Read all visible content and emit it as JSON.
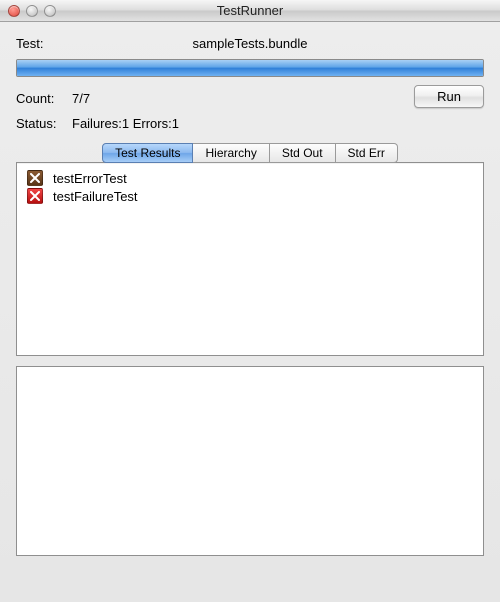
{
  "window": {
    "title": "TestRunner"
  },
  "testLabel": "Test:",
  "testName": "sampleTests.bundle",
  "progress": {
    "percent": 100
  },
  "count": {
    "label": "Count:",
    "value": "7/7"
  },
  "status": {
    "label": "Status:",
    "value": "Failures:1 Errors:1"
  },
  "runButton": "Run",
  "tabs": [
    {
      "label": "Test Results",
      "selected": true
    },
    {
      "label": "Hierarchy",
      "selected": false
    },
    {
      "label": "Std Out",
      "selected": false
    },
    {
      "label": "Std Err",
      "selected": false
    }
  ],
  "results": [
    {
      "name": "testErrorTest",
      "kind": "error"
    },
    {
      "name": "testFailureTest",
      "kind": "failure"
    }
  ],
  "details": ""
}
